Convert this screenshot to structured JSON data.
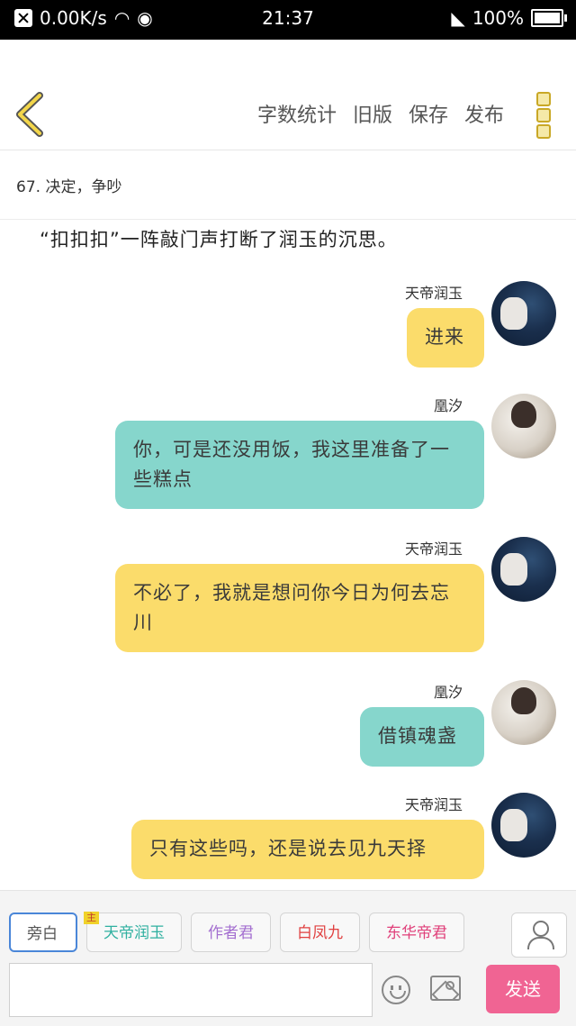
{
  "status_bar": {
    "speed": "0.00K/s",
    "time": "21:37",
    "battery": "100%"
  },
  "appbar": {
    "actions": [
      "字数统计",
      "旧版",
      "保存",
      "发布"
    ]
  },
  "chapter": {
    "title": "67. 决定，争吵"
  },
  "story": {
    "narration": "“扣扣扣”一阵敲门声打断了润玉的沉思。",
    "messages": [
      {
        "speaker": "天帝润玉",
        "text": "进来",
        "color": "yellow"
      },
      {
        "speaker": "凰汐",
        "text": "你，可是还没用饭，我这里准备了一些糕点",
        "color": "teal"
      },
      {
        "speaker": "天帝润玉",
        "text": "不必了，我就是想问你今日为何去忘川",
        "color": "yellow"
      },
      {
        "speaker": "凰汐",
        "text": "借镇魂盏",
        "color": "teal"
      },
      {
        "speaker": "天帝润玉",
        "text": "只有这些吗，还是说去见九天择",
        "color": "yellow"
      }
    ]
  },
  "composer": {
    "roles": [
      {
        "label": "旁白",
        "color": "#555555"
      },
      {
        "label": "天帝润玉",
        "color": "#2fb0a0",
        "tag": "主"
      },
      {
        "label": "作者君",
        "color": "#a46fd0"
      },
      {
        "label": "白凤九",
        "color": "#e04040"
      },
      {
        "label": "东华帝君",
        "color": "#e0407a"
      }
    ],
    "send_label": "发送",
    "colors": {
      "send": "#f06493",
      "active_border": "#4a86d8"
    }
  }
}
